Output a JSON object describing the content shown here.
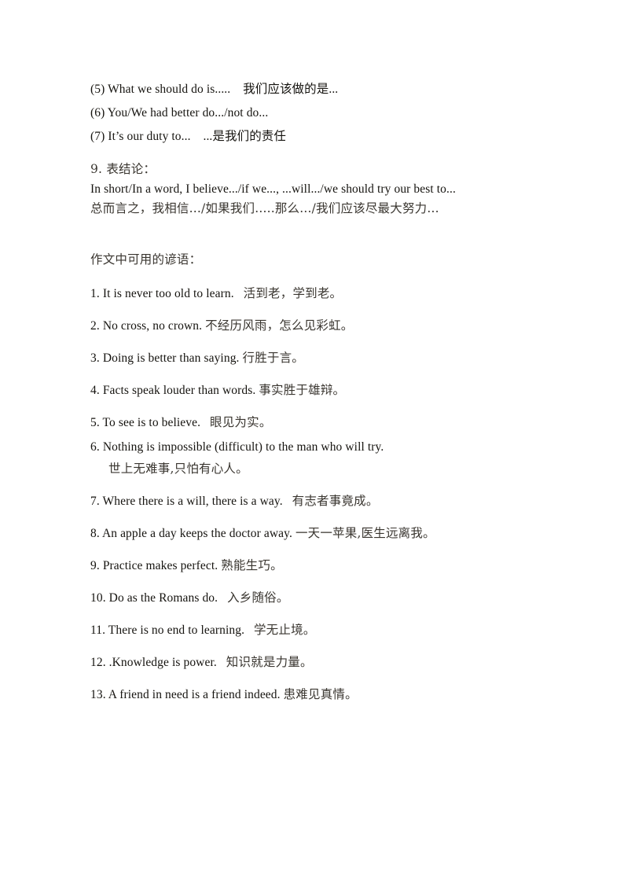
{
  "document": {
    "background_color": "#ffffff",
    "text_color": "#15130f",
    "cn_text_color": "#3a3630"
  },
  "opening_phrases": {
    "items": [
      "(5) What we should do is.....    我们应该做的是...",
      "(6) You/We had better do.../not do...",
      "(7) It’s our duty to...    ...是我们的责任"
    ]
  },
  "conclusion_section": {
    "heading": "9. 表结论：",
    "english": "In short/In a word, I believe.../if we..., ...will.../we should try our best to...",
    "chinese": "总而言之，我相信.../如果我们.....那么.../我们应该尽最大努力..."
  },
  "proverbs_section": {
    "heading": "作文中可用的谚语：",
    "items": [
      {
        "number": "1.",
        "english": "It is never too old to learn.",
        "chinese": "活到老，学到老。",
        "spacer": "   ",
        "wrapped": false
      },
      {
        "number": "2.",
        "english": "No cross, no crown.",
        "chinese": "不经历风雨，怎么见彩虹。",
        "spacer": " ",
        "wrapped": false
      },
      {
        "number": "3.",
        "english": "Doing is better than saying.",
        "chinese": "行胜于言。",
        "spacer": " ",
        "wrapped": false
      },
      {
        "number": "4.",
        "english": "Facts speak louder than words.",
        "chinese": "事实胜于雄辩。",
        "spacer": " ",
        "wrapped": false
      },
      {
        "number": "5.",
        "english": "To see is to believe.",
        "chinese": "眼见为实。",
        "spacer": "   ",
        "wrapped": false
      },
      {
        "number": "6.",
        "english": "Nothing is impossible (difficult) to the man who will try.",
        "chinese": "世上无难事,只怕有心人。",
        "spacer": "",
        "wrapped": true
      },
      {
        "number": "7.",
        "english": "Where there is a will, there is a way.",
        "chinese": "有志者事竟成。",
        "spacer": "   ",
        "wrapped": false
      },
      {
        "number": "8.",
        "english": "An apple a day keeps the doctor away.",
        "chinese": "一天一苹果,医生远离我。",
        "spacer": " ",
        "wrapped": false
      },
      {
        "number": "9.",
        "english": "Practice makes perfect.",
        "chinese": "熟能生巧。",
        "spacer": " ",
        "wrapped": false
      },
      {
        "number": "10.",
        "english": "Do as the Romans do.",
        "chinese": "入乡随俗。",
        "spacer": "   ",
        "wrapped": false
      },
      {
        "number": "11.",
        "english": "There is no end to learning.",
        "chinese": "学无止境。",
        "spacer": "   ",
        "wrapped": false
      },
      {
        "number": "12.",
        "english": ".Knowledge is power.",
        "chinese": "知识就是力量。",
        "spacer": "   ",
        "wrapped": false
      },
      {
        "number": "13.",
        "english": "A friend in need is a friend indeed.",
        "chinese": "患难见真情。",
        "spacer": " ",
        "wrapped": false
      }
    ]
  }
}
